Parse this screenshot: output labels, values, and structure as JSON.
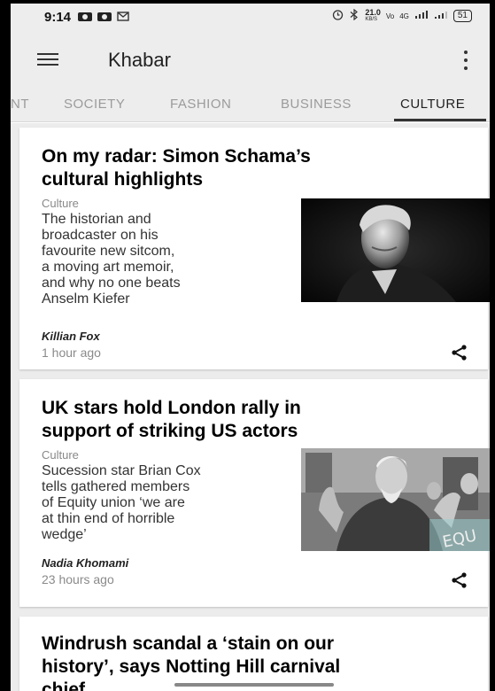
{
  "status_bar": {
    "time": "9:14",
    "net_speed": "21.0",
    "net_unit": "KB/S",
    "network": "4G",
    "battery": "51"
  },
  "app_bar": {
    "title": "Khabar"
  },
  "tabs": [
    "NT",
    "SOCIETY",
    "FASHION",
    "BUSINESS",
    "CULTURE"
  ],
  "active_tab": "CULTURE",
  "articles": [
    {
      "title_line1": "On my radar: Simon Schama’s",
      "title_line2": "cultural highlights",
      "section": "Culture",
      "desc_lines": [
        "The historian and",
        "broadcaster on his",
        "favourite new sitcom,",
        "a moving art memoir,",
        "and why no one beats",
        "Anselm Kiefer"
      ],
      "author": "Killian Fox",
      "time": "1 hour ago"
    },
    {
      "title_line1": "UK stars hold London rally in",
      "title_line2": "support of striking US actors",
      "section": "Culture",
      "desc_lines": [
        "Sucession star Brian Cox",
        "tells gathered members",
        "of Equity union ‘we are",
        "at thin end of horrible",
        "wedge’"
      ],
      "author": "Nadia Khomami",
      "time": "23 hours ago"
    },
    {
      "title_line1": "Windrush scandal a ‘stain on our",
      "title_line2": "history’, says Notting Hill carnival",
      "title_line3": "chief"
    }
  ],
  "colors": {
    "app_bar_bg": "#ededed",
    "feed_bg": "#ececec",
    "inactive_tab": "#9b9b9b",
    "active_tab": "#222222"
  }
}
